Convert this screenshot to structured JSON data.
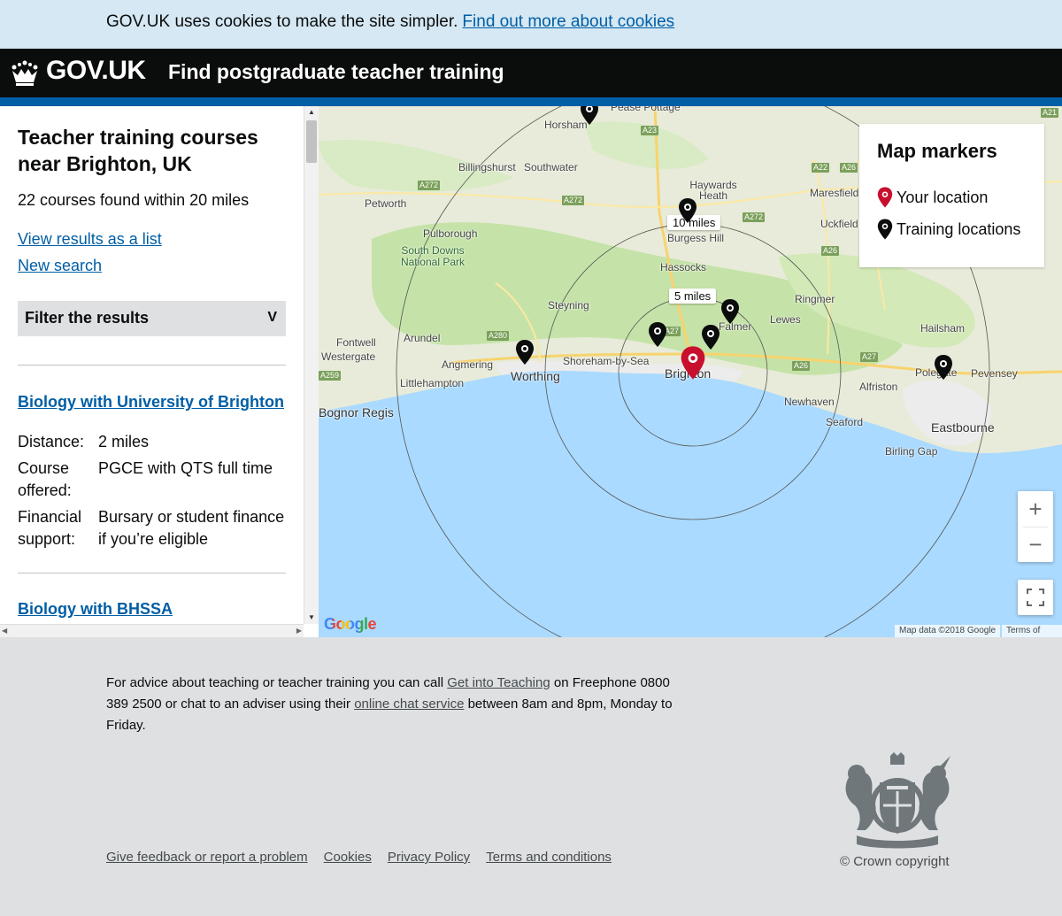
{
  "cookie_banner": {
    "text": "GOV.UK uses cookies to make the site simpler.",
    "link": "Find out more about cookies"
  },
  "header": {
    "logo": "GOV.UK",
    "service_name": "Find postgraduate teacher training"
  },
  "results": {
    "title": "Teacher training courses near Brighton, UK",
    "count": "22 courses found within 20 miles",
    "view_list_link": "View results as a list",
    "new_search_link": "New search",
    "filter_label": "Filter the results",
    "filter_chevron": "V"
  },
  "courses": [
    {
      "title": "Biology with University of Brighton",
      "distance_term": "Distance:",
      "distance": "2 miles",
      "course_term": "Course offered:",
      "course": "PGCE with QTS full time",
      "financial_term": "Financial support:",
      "financial": "Bursary or student finance if you’re eligible"
    },
    {
      "title": "Biology with BHSSA"
    }
  ],
  "map": {
    "legend_title": "Map markers",
    "legend_your_location": "Your location",
    "legend_training_locations": "Training locations",
    "radius_labels": [
      "10 miles",
      "5 miles"
    ],
    "places": [
      "Horsham",
      "Billingshurst",
      "Southwater",
      "Haywards Heath",
      "Burgess Hill",
      "Hassocks",
      "Petworth",
      "Pulborough",
      "South Downs National Park",
      "Steyning",
      "Arundel",
      "Fontwell",
      "Westergate",
      "Angmering",
      "Littlehampton",
      "Worthing",
      "Shoreham-by-Sea",
      "Brighton",
      "Lewes",
      "Ringmer",
      "Maresfield",
      "Uckfield",
      "Hailsham",
      "Polegate",
      "Pevensey",
      "Alfriston",
      "Newhaven",
      "Seaford",
      "Eastbourne",
      "Birling Gap",
      "Bognor Regis",
      "Falmer",
      "Pease Pottage"
    ],
    "roads": [
      "A23",
      "A272",
      "A272",
      "A272",
      "A22",
      "A26",
      "A26",
      "A26",
      "A280",
      "A27",
      "A27",
      "A259",
      "A21"
    ],
    "google": "Google",
    "map_data": "Map data ©2018 Google",
    "terms": "Terms of Use",
    "zoom_in": "+",
    "zoom_out": "−",
    "colors": {
      "water": "#aadaff",
      "land": "#e8ebd9",
      "park": "#c5e3a8",
      "your_location": "#c8102e",
      "training": "#0b0c0c"
    }
  },
  "footer": {
    "advice_1": "For advice about teaching or teacher training you can call",
    "advice_link_1": "Get into Teaching",
    "advice_2": "on Freephone 0800 389 2500 or chat to an adviser using their",
    "advice_link_2": "online chat service",
    "advice_3": "between 8am and 8pm, Monday to Friday.",
    "links": [
      "Give feedback or report a problem",
      "Cookies",
      "Privacy Policy",
      "Terms and conditions"
    ],
    "copyright": "© Crown copyright"
  }
}
